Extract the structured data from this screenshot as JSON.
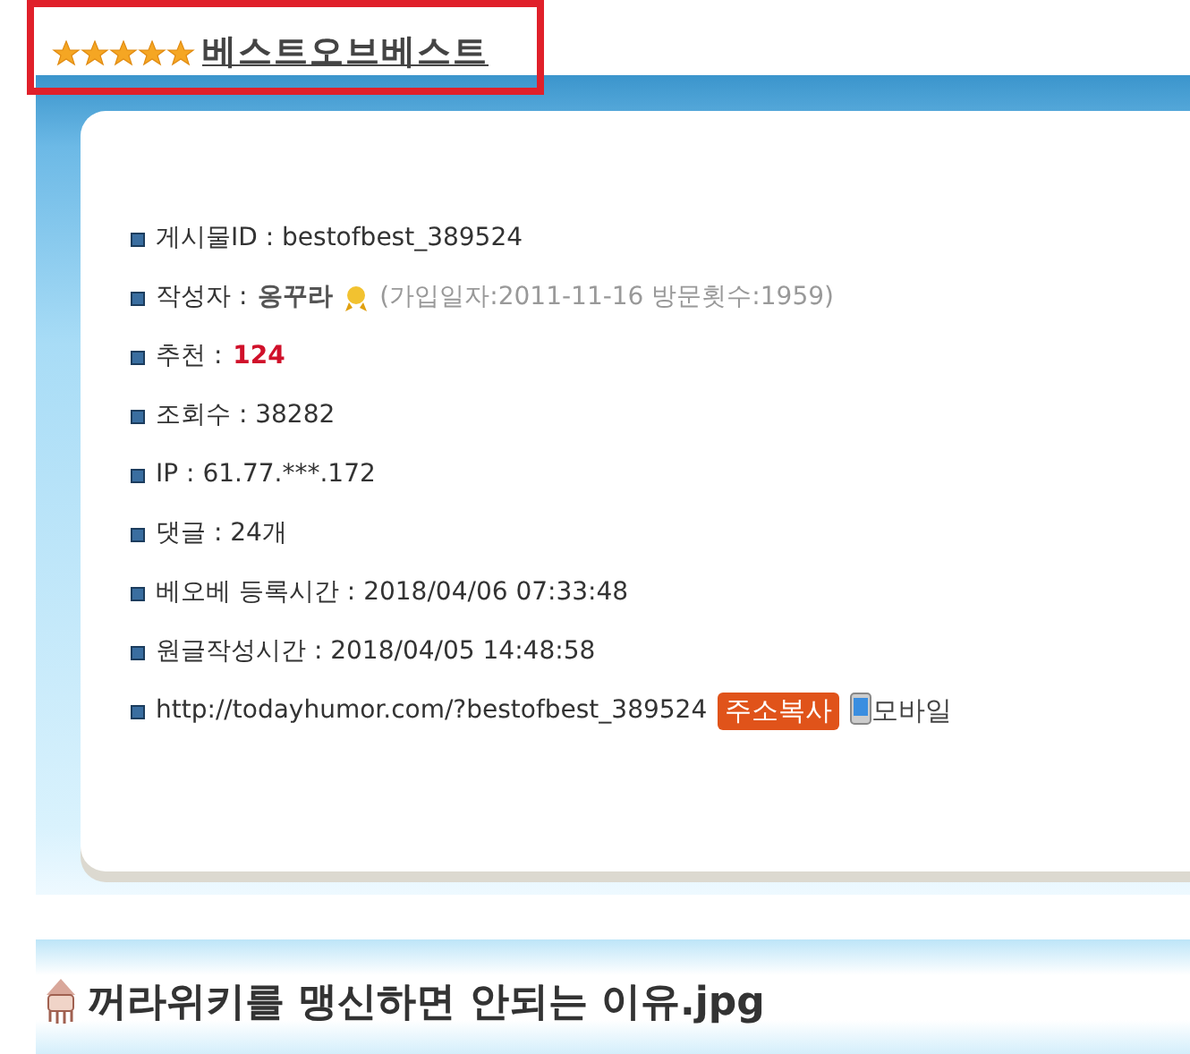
{
  "board_title": "베스트오브베스트",
  "info_rows": [
    {
      "kind": "plain",
      "label": "게시물ID :",
      "value": "bestofbest_389524"
    },
    {
      "kind": "author",
      "label": "작성자 :",
      "value": "옹꾸라",
      "note": "(가입일자:2011-11-16 방문횟수:1959)"
    },
    {
      "kind": "highlight",
      "label": "추천 :",
      "value": "124"
    },
    {
      "kind": "plain",
      "label": "조회수 :",
      "value": "38282"
    },
    {
      "kind": "plain",
      "label": "IP :",
      "value": "61.77.***.172"
    },
    {
      "kind": "plain",
      "label": "댓글 :",
      "value": "24개"
    },
    {
      "kind": "plain",
      "label": "베오베 등록시간 :",
      "value": "2018/04/06 07:33:48"
    },
    {
      "kind": "plain",
      "label": "원글작성시간 :",
      "value": "2018/04/05 14:48:58"
    },
    {
      "kind": "url",
      "value": "http://todayhumor.com/?bestofbest_389524",
      "copy_button": "주소복사",
      "mobile_link": "모바일"
    }
  ],
  "post_title": "꺼라위키를 맹신하면 안되는 이유.jpg"
}
